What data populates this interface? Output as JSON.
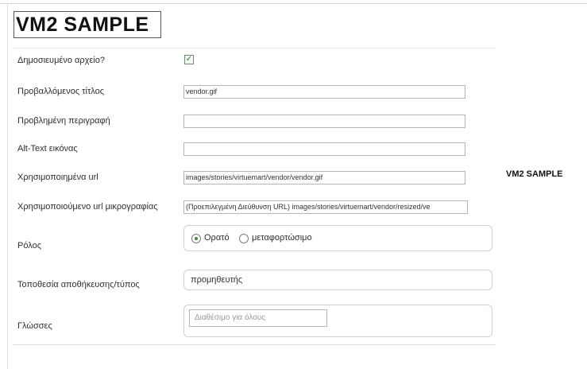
{
  "logo": {
    "text": "VM2 SAMPLE"
  },
  "preview": {
    "text": "VM2 SAMPLE"
  },
  "form": {
    "published": {
      "label": "Δημοσιευμένο αρχείο?",
      "checked": true,
      "check_glyph": "✓"
    },
    "display_title": {
      "label": "Προβαλλόμενος τίτλος",
      "value": "vendor.gif"
    },
    "description": {
      "label": "Προβλημένη περιγραφή",
      "value": ""
    },
    "alt_text": {
      "label": "Alt-Text εικόνας",
      "value": ""
    },
    "url": {
      "label": "Χρησιμοποιημένα url",
      "value": "images/stories/virtuemart/vendor/vendor.gif"
    },
    "thumb_url": {
      "label": "Χρησιμοποιούμενο url μικρογραφίας",
      "value": "(Προεπιλεγμένη Διεύθυνση URL) images/stories/virtuemart/vendor/resized/ve"
    },
    "role": {
      "label": "Ρόλος",
      "options": [
        {
          "label": "Ορατό",
          "selected": true
        },
        {
          "label": "μεταφορτώσιμο",
          "selected": false
        }
      ]
    },
    "location": {
      "label": "Τοποθεσία αποθήκευσης/τύπος",
      "value": "προμηθευτής"
    },
    "languages": {
      "label": "Γλώσσες",
      "placeholder": "Διαθέσιμο για όλους"
    }
  },
  "colors": {
    "accent_check": "#2f7a2f",
    "border": "#b5b5b5"
  }
}
